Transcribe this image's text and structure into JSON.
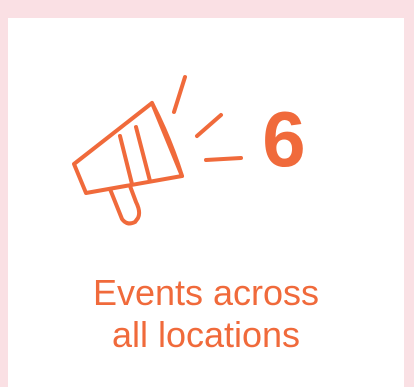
{
  "colors": {
    "page_background": "#fae0e4",
    "card_background": "#ffffff",
    "accent": "#f06a3b"
  },
  "icon": {
    "name": "megaphone-icon"
  },
  "stat": {
    "value": "6",
    "label": "Events across\nall locations"
  }
}
